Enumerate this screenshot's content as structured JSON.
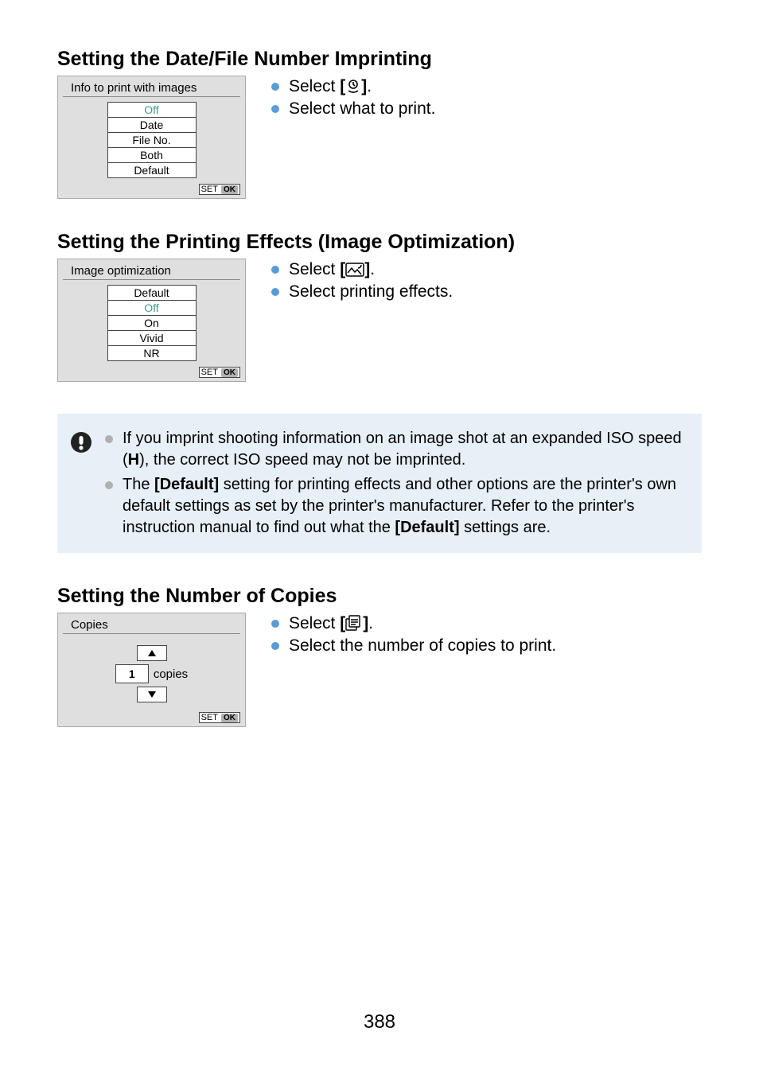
{
  "page_number": "388",
  "section1": {
    "title": "Setting the Date/File Number Imprinting",
    "menu_title": "Info to print with images",
    "items": [
      "Off",
      "Date",
      "File No.",
      "Both",
      "Default"
    ],
    "selected_index": 0,
    "set_label": "SET",
    "ok_label": "OK",
    "instr1_pre": "Select ",
    "instr1_bracket_open": "[",
    "instr1_bracket_close": "]",
    "instr1_post": ".",
    "instr2": "Select what to print."
  },
  "section2": {
    "title": "Setting the Printing Effects (Image Optimization)",
    "menu_title": "Image optimization",
    "items": [
      "Default",
      "Off",
      "On",
      "Vivid",
      "NR"
    ],
    "selected_index": 1,
    "set_label": "SET",
    "ok_label": "OK",
    "instr1_pre": "Select ",
    "instr1_bracket_open": "[",
    "instr1_bracket_close": "]",
    "instr1_post": ".",
    "instr2": "Select printing effects."
  },
  "note": {
    "item1_a": "If you imprint shooting information on an image shot at an expanded ISO speed (",
    "item1_bold": "H",
    "item1_b": "), the correct ISO speed may not be imprinted.",
    "item2_a": "The ",
    "item2_bold1": "[Default]",
    "item2_b": " setting for printing effects and other options are the printer's own default settings as set by the printer's manufacturer. Refer to the printer's instruction manual to find out what the ",
    "item2_bold2": "[Default]",
    "item2_c": " settings are."
  },
  "section3": {
    "title": "Setting the Number of Copies",
    "menu_title": "Copies",
    "value": "1",
    "unit": "copies",
    "set_label": "SET",
    "ok_label": "OK",
    "instr1_pre": "Select ",
    "instr1_bracket_open": "[",
    "instr1_bracket_close": "]",
    "instr1_post": ".",
    "instr2": "Select the number of copies to print."
  }
}
